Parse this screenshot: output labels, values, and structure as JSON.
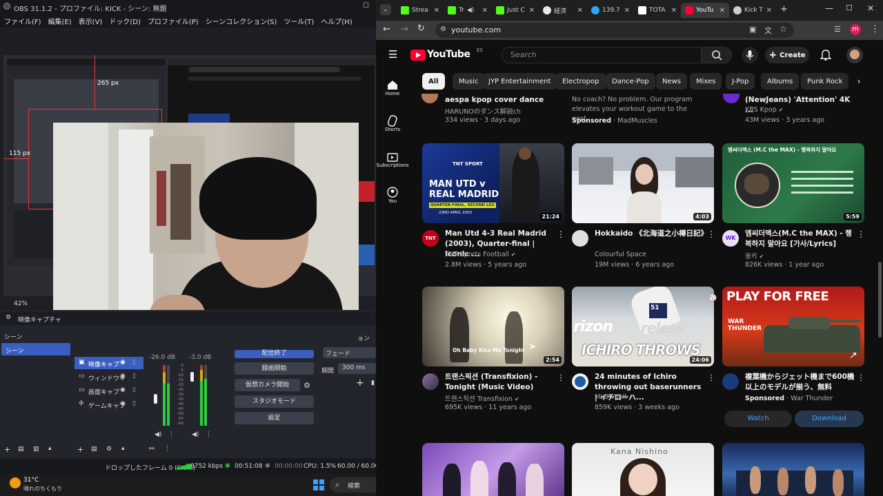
{
  "obs": {
    "title": "OBS 31.1.2 - プロファイル: KICK - シーン: 無題",
    "menu": [
      "ファイル(F)",
      "編集(E)",
      "表示(V)",
      "ドック(D)",
      "プロファイル(P)",
      "シーンコレクション(S)",
      "ツール(T)",
      "ヘルプ(H)"
    ],
    "preview_labels": {
      "width_px": "265 px",
      "height_px": "115 px",
      "zoom": "42%"
    },
    "source_bar_label": "映像キャプチャ",
    "scenes_header": "シーン",
    "scene_item": "シーン",
    "sources": [
      "映像キャプ",
      "ウィンドウキ",
      "画面キャプ",
      "ゲームキャプ"
    ],
    "mixer": {
      "db_left": "-26.0 dB",
      "db_right": "-3.0 dB",
      "ticks": [
        "0",
        "-5",
        "-10",
        "-15",
        "-20",
        "-25",
        "-30",
        "-35",
        "-40",
        "-45",
        "-50",
        "-55",
        "-60"
      ]
    },
    "transition": {
      "type": "フェード",
      "duration_label": "期間",
      "duration": "300 ms",
      "header_fragment": "ョン"
    },
    "controls": [
      "配信終了",
      "録画開始",
      "仮想カメラ開始",
      "スタジオモード",
      "設定"
    ],
    "status": {
      "dropped": "ドロップしたフレーム 0 (0.0%)",
      "bitrate": "8752 kbps",
      "stream_time": "00:51:08",
      "rec_time": "00:00:00",
      "cpu": "CPU: 1.5%",
      "fps": "60.00 / 60.00 FPS"
    }
  },
  "taskbar": {
    "weather_temp": "31°C",
    "weather_text": "晴れのちくもり",
    "search_label": "検索"
  },
  "chrome": {
    "tabs": [
      {
        "label": "Strea",
        "color": "#53fc18"
      },
      {
        "label": "Tr",
        "color": "#53fc18"
      },
      {
        "label": "Just C",
        "color": "#53fc18"
      },
      {
        "label": "経済",
        "color": "#e8e8e8"
      },
      {
        "label": "139.7",
        "color": "#2aa7ff"
      },
      {
        "label": "TOTA",
        "color": "#ffffff"
      },
      {
        "label": "YouTu",
        "color": "#ff0033"
      },
      {
        "label": "Kick T",
        "color": "#cccccc"
      }
    ],
    "url": "youtube.com",
    "profile_initial": "m"
  },
  "youtube": {
    "logo_text": "YouTube",
    "region": "ES",
    "search_placeholder": "Search",
    "create_label": "Create",
    "guide": [
      {
        "label": "Home",
        "icon": "home-icon"
      },
      {
        "label": "Shorts",
        "icon": "shorts-icon"
      },
      {
        "label": "Subscriptions",
        "icon": "subscriptions-icon"
      },
      {
        "label": "You",
        "icon": "you-icon"
      }
    ],
    "chips": [
      "All",
      "Music",
      "JYP Entertainment",
      "Electropop",
      "Dance-Pop",
      "News",
      "Mixes",
      "J-Pop",
      "Albums",
      "Punk Rock"
    ],
    "top_row": [
      {
        "title": "aespa kpop cover  dance",
        "channel": "HARUNOのダンス解説ch",
        "meta": "334 views · 3 days ago"
      },
      {
        "title": "No coach? No problem. Our program elevates your workout game to the next...",
        "sponsored": "Sponsored",
        "channel": "MadMuscles"
      },
      {
        "title": "(NewJeans) 'Attention' 4K ...",
        "channel": "KBS Kpop",
        "meta": "43M views · 3 years ago"
      }
    ],
    "row2": [
      {
        "title": "Man Utd 4-3 Real Madrid (2003), Quarter-final | Iconic ...",
        "channel": "TNT Sports Football",
        "meta": "2.8M views · 5 years ago",
        "duration": "21:24",
        "thumb_text1": "MAN UTD v",
        "thumb_text2": "REAL MADRID",
        "thumb_text3": "QUARTER-FINAL, SECOND LEG",
        "thumb_text4": "23RD APRIL 2003",
        "thumb_brand": "TNT SPORT",
        "avatar_text": "TNT"
      },
      {
        "title": "Hokkaido 《北海道之小樽日記》",
        "channel": "Colourful Space",
        "meta": "19M views · 6 years ago",
        "duration": "4:03"
      },
      {
        "title": "엠씨더맥스(M.C the MAX) - 행복하지 말아요 [가사/Lyrics]",
        "channel": "옹키",
        "meta": "826K views · 1 year ago",
        "duration": "5:59",
        "thumb_text1": "엠씨더맥스 (M.C the MAX) - 행복하지 말아요",
        "avatar_text": "WK"
      }
    ],
    "row3": [
      {
        "title": "트랜스픽션 (Transfixion) - Tonight (Music Video)",
        "channel": "트랜스픽션 Transfixion",
        "meta": "695K views · 11 years ago",
        "duration": "2:54",
        "thumb_text1": "Oh Baby Kiss Me Tonight"
      },
      {
        "title": "24 minutes of Ichiro throwing out baserunners | イチローハ...",
        "channel": "MLB Vault",
        "meta": "859K views · 3 weeks ago",
        "duration": "24:06",
        "thumb_text1": "rizon",
        "thumb_text2": "reless",
        "thumb_text3": "ICHIRO THROWS"
      },
      {
        "title": "複葉機からジェット機まで600機以上のモデルが揃う、無料",
        "sponsored": "Sponsored",
        "channel": "War Thunder",
        "thumb_text1": "PLAY FOR FREE",
        "thumb_text2": "WAR THUNDER",
        "watch_label": "Watch",
        "download_label": "Download"
      }
    ],
    "row4_thumb_text": "Kana Nishino"
  }
}
